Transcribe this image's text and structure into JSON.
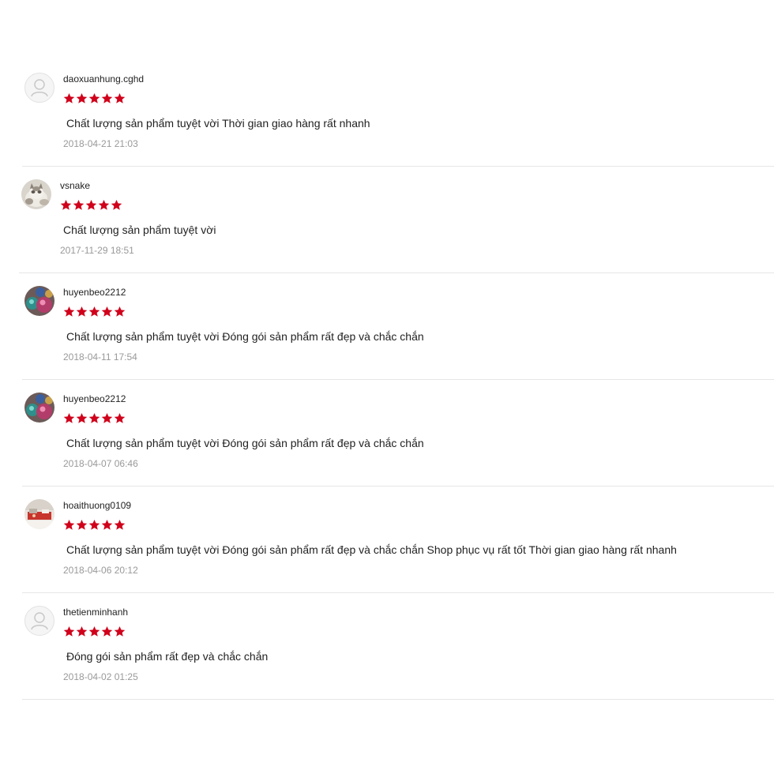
{
  "star_color": "#d0011b",
  "reviews": [
    {
      "username": "daoxuanhung.cghd",
      "rating": 5,
      "comment": "Chất lượng sản phẩm tuyệt vời Thời gian giao hàng rất nhanh",
      "time": "2018-04-21 21:03",
      "avatar": "default-avatar-icon"
    },
    {
      "username": "vsnake",
      "rating": 5,
      "comment": "Chất lượng sản phẩm tuyệt vời",
      "time": "2017-11-29 18:51",
      "avatar": "cat-photo-avatar"
    },
    {
      "username": "huyenbeo2212",
      "rating": 5,
      "comment": "Chất lượng sản phẩm tuyệt vời Đóng gói sản phẩm rất đẹp và chắc chắn",
      "time": "2018-04-11 17:54",
      "avatar": "ornaments-photo-avatar"
    },
    {
      "username": "huyenbeo2212",
      "rating": 5,
      "comment": "Chất lượng sản phẩm tuyệt vời Đóng gói sản phẩm rất đẹp và chắc chắn",
      "time": "2018-04-07 06:46",
      "avatar": "ornaments-photo-avatar"
    },
    {
      "username": "hoaithuong0109",
      "rating": 5,
      "comment": "Chất lượng sản phẩm tuyệt vời Đóng gói sản phẩm rất đẹp và chắc chắn Shop phục vụ rất tốt Thời gian giao hàng rất nhanh",
      "time": "2018-04-06 20:12",
      "avatar": "room-photo-avatar"
    },
    {
      "username": "thetienminhanh",
      "rating": 5,
      "comment": "Đóng gói sản phẩm rất đẹp và chắc chắn",
      "time": "2018-04-02 01:25",
      "avatar": "default-avatar-icon"
    }
  ]
}
